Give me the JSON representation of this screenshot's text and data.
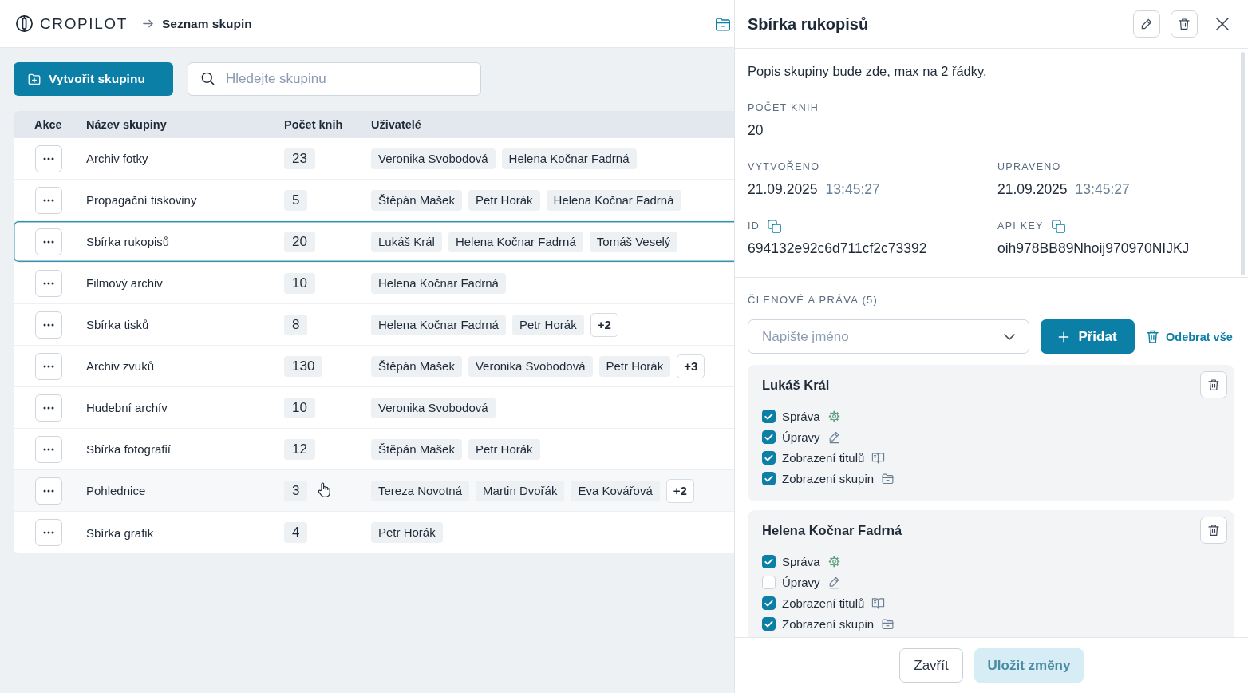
{
  "header": {
    "logo": "CROPILOT",
    "breadcrumb": "Seznam skupin"
  },
  "toolbar": {
    "create_button": "Vytvořit skupinu",
    "search": {
      "placeholder": "Hledejte skupinu"
    }
  },
  "table": {
    "columns": [
      "Akce",
      "Název skupiny",
      "Počet knih",
      "Uživatelé"
    ],
    "rows": [
      {
        "name": "Archiv fotky",
        "count": "23",
        "users": [
          {
            "kind": "person",
            "label": "Veronika Svobodová"
          },
          {
            "kind": "person",
            "label": "Helena Kočnar Fadrná"
          }
        ],
        "selected": false,
        "hovered": false
      },
      {
        "name": "Propagační tiskoviny",
        "count": "5",
        "users": [
          {
            "kind": "person",
            "label": "Štěpán Mašek"
          },
          {
            "kind": "person",
            "label": "Petr Horák"
          },
          {
            "kind": "person",
            "label": "Helena Kočnar Fadrná"
          }
        ],
        "selected": false,
        "hovered": false
      },
      {
        "name": "Sbírka rukopisů",
        "count": "20",
        "users": [
          {
            "kind": "person",
            "label": "Lukáš Král"
          },
          {
            "kind": "person",
            "label": "Helena Kočnar Fadrná"
          },
          {
            "kind": "person",
            "label": "Tomáš Veselý"
          }
        ],
        "selected": true,
        "hovered": false
      },
      {
        "name": "Filmový archiv",
        "count": "10",
        "users": [
          {
            "kind": "person",
            "label": "Helena Kočnar Fadrná"
          }
        ],
        "selected": false,
        "hovered": false
      },
      {
        "name": "Sbírka tisků",
        "count": "8",
        "users": [
          {
            "kind": "person",
            "label": "Helena Kočnar Fadrná"
          },
          {
            "kind": "person",
            "label": "Petr Horák"
          },
          {
            "kind": "overflow",
            "label": "+2"
          }
        ],
        "selected": false,
        "hovered": false
      },
      {
        "name": "Archiv zvuků",
        "count": "130",
        "users": [
          {
            "kind": "person",
            "label": "Štěpán Mašek"
          },
          {
            "kind": "person",
            "label": "Veronika Svobodová"
          },
          {
            "kind": "person",
            "label": "Petr Horák"
          },
          {
            "kind": "overflow",
            "label": "+3"
          }
        ],
        "selected": false,
        "hovered": false
      },
      {
        "name": "Hudební archív",
        "count": "10",
        "users": [
          {
            "kind": "person",
            "label": "Veronika Svobodová"
          }
        ],
        "selected": false,
        "hovered": false
      },
      {
        "name": "Sbírka fotografií",
        "count": "12",
        "users": [
          {
            "kind": "person",
            "label": "Štěpán Mašek"
          },
          {
            "kind": "person",
            "label": "Petr Horák"
          }
        ],
        "selected": false,
        "hovered": false
      },
      {
        "name": "Pohlednice",
        "count": "3",
        "users": [
          {
            "kind": "person",
            "label": "Tereza Novotná"
          },
          {
            "kind": "person",
            "label": "Martin Dvořák"
          },
          {
            "kind": "person",
            "label": "Eva Kovářová"
          },
          {
            "kind": "overflow",
            "label": "+2"
          }
        ],
        "selected": false,
        "hovered": true
      },
      {
        "name": "Sbírka grafik",
        "count": "4",
        "users": [
          {
            "kind": "person",
            "label": "Petr Horák"
          }
        ],
        "selected": false,
        "hovered": false
      }
    ]
  },
  "detail": {
    "title": "Sbírka rukopisů",
    "description": "Popis skupiny bude zde, max na 2 řádky.",
    "field_rows": [
      [
        {
          "kind": "plain",
          "label": "POČET KNIH",
          "value": "20"
        }
      ],
      [
        {
          "kind": "datetime",
          "label": "VYTVOŘENO",
          "value": "21.09.2025",
          "time": "13:45:27"
        },
        {
          "kind": "datetime",
          "label": "UPRAVENO",
          "value": "21.09.2025",
          "time": "13:45:27"
        }
      ],
      [
        {
          "kind": "copyable",
          "label": "ID",
          "value": "694132e92c6d711cf2c73392"
        },
        {
          "kind": "copyable",
          "label": "API KEY",
          "value": "oih978BB89Nhoij970970NIJKJ"
        }
      ]
    ],
    "members": {
      "title": "ČLENOVÉ A PRÁVA (5)",
      "name_field": {
        "placeholder": "Napište jméno"
      },
      "add_button": "Přidat",
      "remove_all": "Odebrat vše",
      "list": [
        {
          "name": "Lukáš Král",
          "permissions": [
            {
              "kind": "admin",
              "label": "Správa",
              "checked": true
            },
            {
              "kind": "edit",
              "label": "Úpravy",
              "checked": true
            },
            {
              "kind": "titles",
              "label": "Zobrazení titulů",
              "checked": true
            },
            {
              "kind": "groups",
              "label": "Zobrazení skupin",
              "checked": true
            }
          ]
        },
        {
          "name": "Helena Kočnar Fadrná",
          "permissions": [
            {
              "kind": "admin",
              "label": "Správa",
              "checked": true
            },
            {
              "kind": "edit",
              "label": "Úpravy",
              "checked": false
            },
            {
              "kind": "titles",
              "label": "Zobrazení titulů",
              "checked": true
            },
            {
              "kind": "groups",
              "label": "Zobrazení skupin",
              "checked": true
            }
          ]
        }
      ]
    }
  },
  "footer": [
    {
      "kind": "secondary",
      "label": "Zavřít",
      "disabled": false
    },
    {
      "kind": "primary",
      "label": "Uložit změny",
      "disabled": true
    }
  ]
}
